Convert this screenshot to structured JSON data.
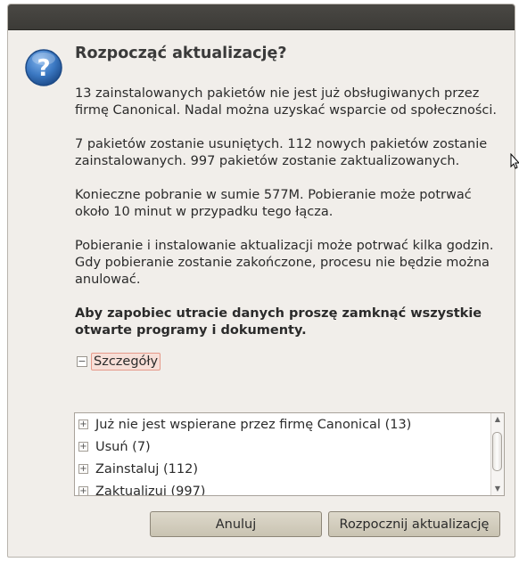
{
  "dialog": {
    "title": "Rozpocząć aktualizację?",
    "paragraphs": [
      "13 zainstalowanych pakietów nie jest już obsługiwanych przez firmę Canonical. Nadal można uzyskać wsparcie od społeczności.",
      "7 pakietów zostanie usuniętych. 112 nowych pakietów zostanie zainstalowanych. 997 pakietów zostanie zaktualizowanych.",
      "Konieczne pobranie w sumie 577M. Pobieranie może potrwać około 10 minut w przypadku tego łącza.",
      "Pobieranie i instalowanie aktualizacji może potrwać kilka godzin. Gdy pobieranie zostanie zakończone, procesu nie będzie można anulować."
    ],
    "warning": "Aby zapobiec utracie danych proszę zamknąć wszystkie otwarte programy i dokumenty.",
    "details_label": "Szczegóły",
    "details_items": [
      "Już nie jest wspierane przez firmę Canonical (13)",
      "Usuń (7)",
      "Zainstaluj (112)",
      "Zaktualizuj (997)"
    ],
    "cancel_label": "Anuluj",
    "start_label": "Rozpocznij aktualizację"
  },
  "colors": {
    "accent": "#e69a8a",
    "titlebar": "#3c3b37",
    "dialog_bg": "#f1eeea",
    "question_icon": "#3b78c2"
  },
  "icons": {
    "dialog_icon": "question-icon",
    "expander": "minus-box-icon",
    "tree_expander": "plus-box-icon"
  }
}
